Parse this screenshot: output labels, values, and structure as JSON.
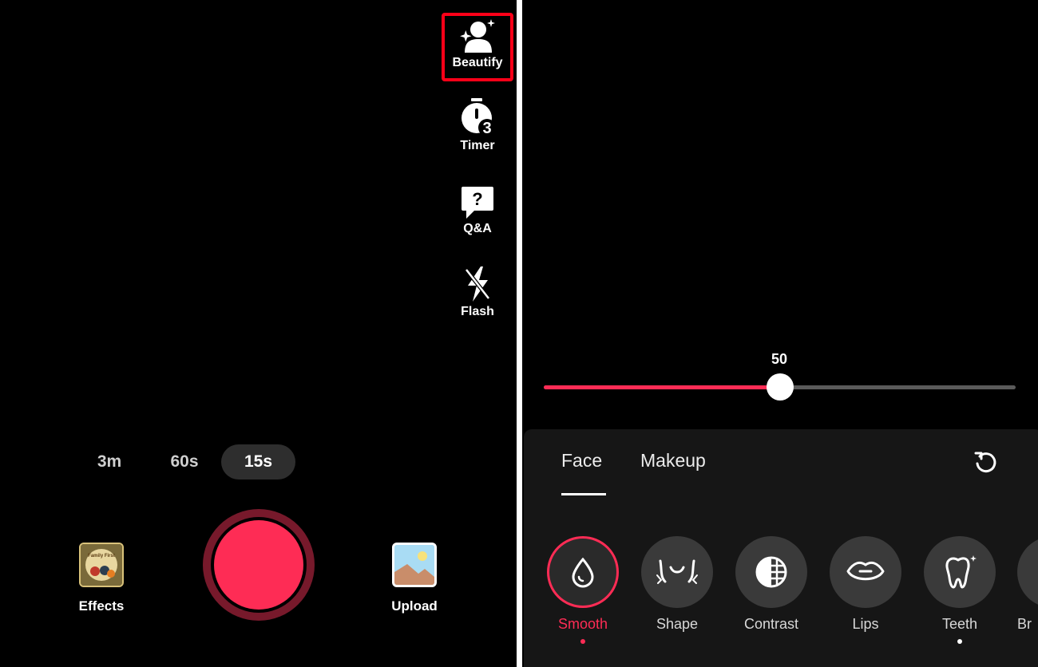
{
  "left": {
    "tools": {
      "beautify": "Beautify",
      "timer": "Timer",
      "qa": "Q&A",
      "flash": "Flash"
    },
    "durations": [
      "3m",
      "60s",
      "15s"
    ],
    "selected_duration": "15s",
    "effects_label": "Effects",
    "upload_label": "Upload",
    "effects_thumb_text": "Family First"
  },
  "right": {
    "slider": {
      "value": "50",
      "fraction": 0.5
    },
    "tabs": {
      "face": "Face",
      "makeup": "Makeup"
    },
    "options": {
      "smooth": "Smooth",
      "shape": "Shape",
      "contrast": "Contrast",
      "lips": "Lips",
      "teeth": "Teeth",
      "partial": "Br"
    }
  },
  "colors": {
    "accent": "#fe2c55",
    "highlight": "#ff0018",
    "record_ring": "#77192b"
  }
}
